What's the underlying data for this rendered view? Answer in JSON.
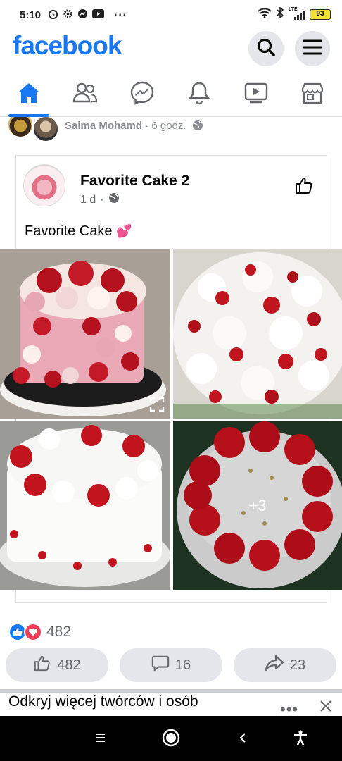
{
  "status_bar": {
    "time": "5:10",
    "network_label": "LTE",
    "battery": "93"
  },
  "header": {
    "logo": "facebook",
    "search_icon": "search-icon",
    "menu_icon": "hamburger-menu-icon"
  },
  "nav": {
    "items": [
      {
        "icon": "home-icon",
        "active": true
      },
      {
        "icon": "friends-icon",
        "active": false
      },
      {
        "icon": "messenger-icon",
        "active": false
      },
      {
        "icon": "bell-icon",
        "active": false
      },
      {
        "icon": "video-icon",
        "active": false
      },
      {
        "icon": "marketplace-icon",
        "active": false
      }
    ],
    "accent": "#1877f2"
  },
  "shared_row": {
    "name": "Salma Mohamd",
    "time": "6 godz.",
    "sep": "·"
  },
  "post": {
    "page_name": "Favorite Cake 2",
    "time": "1 d",
    "sep": "·",
    "caption": "Favorite Cake",
    "caption_emoji": "💕",
    "more_photos": "+3"
  },
  "reactions": {
    "count": "482"
  },
  "actions": {
    "like_count": "482",
    "comment_count": "16",
    "share_count": "23"
  },
  "discover": {
    "title": "Odkryj więcej twórców i osób",
    "more": "•••"
  }
}
